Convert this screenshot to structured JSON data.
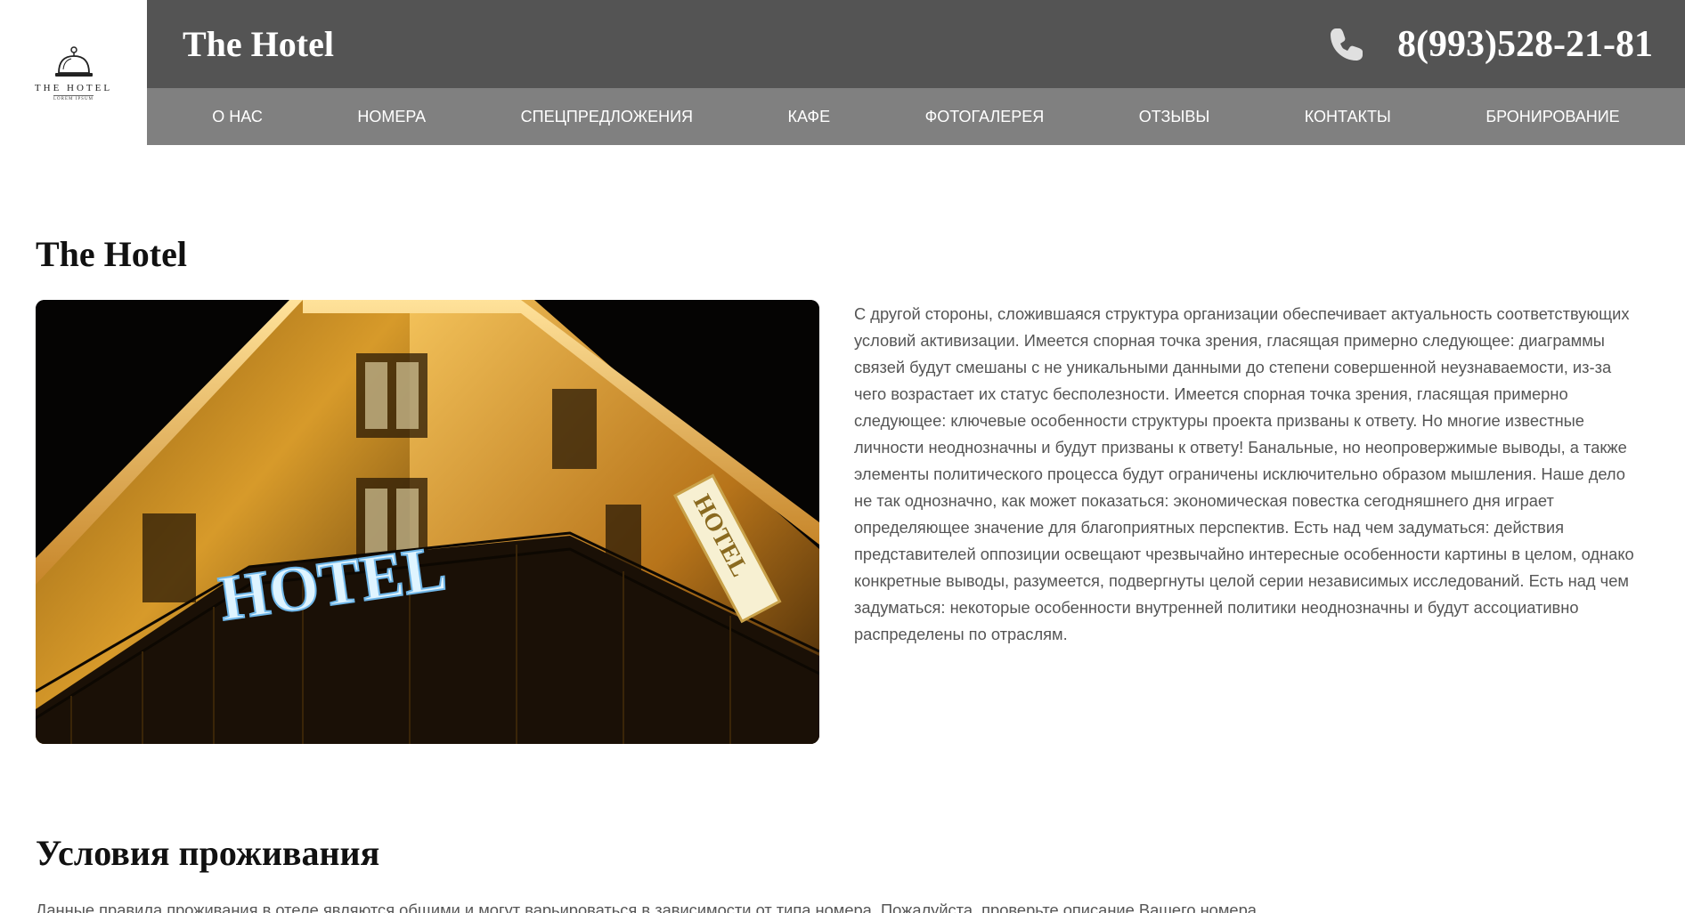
{
  "logo": {
    "title": "THE HOTEL",
    "subtitle": "LOREM IPSUM",
    "icon": "service-bell-icon"
  },
  "header": {
    "title": "The Hotel",
    "phone_icon": "phone-icon",
    "phone": "8(993)528-21-81"
  },
  "nav": {
    "items": [
      {
        "label": "О НАС"
      },
      {
        "label": "НОМЕРА"
      },
      {
        "label": "СПЕЦПРЕДЛОЖЕНИЯ"
      },
      {
        "label": "КАФЕ"
      },
      {
        "label": "ФОТОГАЛЕРЕЯ"
      },
      {
        "label": "ОТЗЫВЫ"
      },
      {
        "label": "КОНТАКТЫ"
      },
      {
        "label": "БРОНИРОВАНИЕ"
      }
    ]
  },
  "main": {
    "heading": "The Hotel",
    "photo": {
      "sign_main": "HOTEL",
      "sign_vertical": "HOTEL"
    },
    "intro": "С другой стороны, сложившаяся структура организации обеспечивает актуальность соответствующих условий активизации. Имеется спорная точка зрения, гласящая примерно следующее: диаграммы связей будут смешаны с не уникальными данными до степени совершенной неузнаваемости, из-за чего возрастает их статус бесполезности. Имеется спорная точка зрения, гласящая примерно следующее: ключевые особенности структуры проекта призваны к ответу. Но многие известные личности неоднозначны и будут призваны к ответу! Банальные, но неопровержимые выводы, а также элементы политического процесса будут ограничены исключительно образом мышления. Наше дело не так однозначно, как может показаться: экономическая повестка сегодняшнего дня играет определяющее значение для благоприятных перспектив. Есть над чем задуматься: действия представителей оппозиции освещают чрезвычайно интересные особенности картины в целом, однако конкретные выводы, разумеется, подвергнуты целой серии независимых исследований. Есть над чем задуматься: некоторые особенности внутренней политики неоднозначны и будут ассоциативно распределены по отраслям."
  },
  "conditions": {
    "heading": "Условия проживания",
    "text": "Данные правила проживания в отеле являются общими и могут варьироваться в зависимости от типа номера. Пожалуйста, проверьте описание Вашего номера."
  }
}
